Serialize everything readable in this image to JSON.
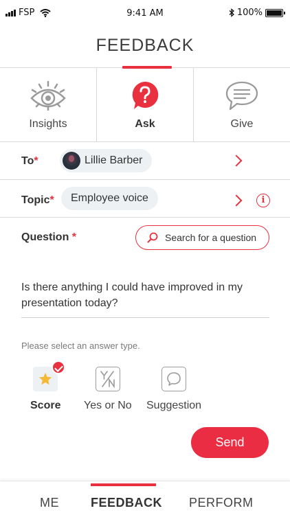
{
  "status_bar": {
    "carrier": "FSP",
    "time": "9:41 AM",
    "battery": "100%",
    "battery_level": 1.0
  },
  "header": {
    "title": "FEEDBACK"
  },
  "mode_tabs": [
    {
      "label": "Insights",
      "icon": "eye-icon",
      "active": false
    },
    {
      "label": "Ask",
      "icon": "question-bubble-icon",
      "active": true
    },
    {
      "label": "Give",
      "icon": "chat-bubble-icon",
      "active": false
    }
  ],
  "form": {
    "to": {
      "label": "To",
      "required_mark": "*",
      "value": "Lillie Barber"
    },
    "topic": {
      "label": "Topic",
      "required_mark": "*",
      "value": "Employee voice"
    },
    "question": {
      "label": "Question",
      "required_mark": " *",
      "search_label": "Search for a question",
      "text": "Is there anything I could have improved in my presentation today?"
    },
    "answer_hint": "Please select an answer type.",
    "answer_types": [
      {
        "label": "Score",
        "icon": "star-icon",
        "selected": true
      },
      {
        "label": "Yes or No",
        "icon": "yes-no-icon",
        "selected": false
      },
      {
        "label": "Suggestion",
        "icon": "speech-bubble-icon",
        "selected": false
      }
    ],
    "send_label": "Send"
  },
  "bottom_nav": [
    {
      "label": "ME",
      "active": false
    },
    {
      "label": "FEEDBACK",
      "active": true
    },
    {
      "label": "PERFORM",
      "active": false
    }
  ],
  "colors": {
    "accent": "#e8303e",
    "chip_bg": "#eef1f4",
    "icon_grey": "#9a9a9a",
    "star": "#f5b935"
  }
}
